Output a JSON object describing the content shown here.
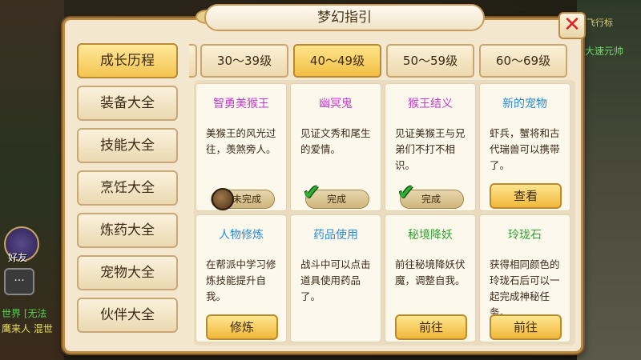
{
  "window": {
    "title": "梦幻指引"
  },
  "close_glyph": "✕",
  "background": {
    "friend_label": "好友",
    "world_line1": "世界 [无法",
    "world_line2": "鹰来人 混世",
    "right_top": "飞行标",
    "right_text": "大速元帅"
  },
  "sidebar": {
    "items": [
      {
        "label": "成长历程",
        "active": true
      },
      {
        "label": "装备大全",
        "active": false
      },
      {
        "label": "技能大全",
        "active": false
      },
      {
        "label": "烹饪大全",
        "active": false
      },
      {
        "label": "炼药大全",
        "active": false
      },
      {
        "label": "宠物大全",
        "active": false
      },
      {
        "label": "伙伴大全",
        "active": false
      }
    ]
  },
  "tabs": [
    {
      "label": "30～39级",
      "active": false
    },
    {
      "label": "40～49级",
      "active": true
    },
    {
      "label": "50～59级",
      "active": false
    },
    {
      "label": "60～69级",
      "active": false
    }
  ],
  "cards": [
    {
      "title": "智勇美猴王",
      "title_color": "#c33ad1",
      "desc": "美猴王的风光过往，羡煞旁人。",
      "status": "未完成",
      "status_kind": "incomplete"
    },
    {
      "title": "幽冥鬼",
      "title_color": "#c33ad1",
      "desc": "见证文秀和尾生的爱情。",
      "status": "完成",
      "status_kind": "complete"
    },
    {
      "title": "猴王结义",
      "title_color": "#c33ad1",
      "desc": "见证美猴王与兄弟们不打不相识。",
      "status": "完成",
      "status_kind": "complete"
    },
    {
      "title": "新的宠物",
      "title_color": "#2a8ad8",
      "desc": "虾兵，蟹将和古代瑞兽可以携带了。",
      "button": "查看"
    },
    {
      "title": "人物修炼",
      "title_color": "#2a8ad8",
      "desc": "在帮派中学习修炼技能提升自我。",
      "button": "修炼"
    },
    {
      "title": "药品使用",
      "title_color": "#2a8ad8",
      "desc": "战斗中可以点击道具使用药品了。"
    },
    {
      "title": "秘境降妖",
      "title_color": "#2fa32f",
      "desc": "前往秘境降妖伏魔，调整自我。",
      "button": "前往"
    },
    {
      "title": "玲珑石",
      "title_color": "#2fa32f",
      "desc": "获得相同颜色的玲珑石后可以一起完成神秘任务。",
      "button": "前往"
    }
  ],
  "colors": {
    "accent_gold": "#f2bf45",
    "panel_bg": "#f3e8cf",
    "complete_check": "#2fb12f",
    "close_red": "#dd2222"
  }
}
